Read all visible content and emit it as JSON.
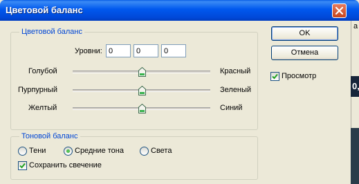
{
  "window": {
    "title": "Цветовой баланс",
    "close_icon": "close-icon"
  },
  "background": {
    "top_glyph": "а",
    "dark_text": "0,"
  },
  "color_balance": {
    "legend": "Цветовой баланс",
    "levels_label": "Уровни:",
    "levels": [
      "0",
      "0",
      "0"
    ],
    "sliders": [
      {
        "left": "Голубой",
        "right": "Красный",
        "value": 0
      },
      {
        "left": "Пурпурный",
        "right": "Зеленый",
        "value": 0
      },
      {
        "left": "Желтый",
        "right": "Синий",
        "value": 0
      }
    ],
    "slider_range": [
      -100,
      100
    ]
  },
  "tone_balance": {
    "legend": "Тоновой баланс",
    "options": [
      "Тени",
      "Средние тона",
      "Света"
    ],
    "selected": "Средние тона",
    "preserve_label": "Сохранить свечение",
    "preserve_checked": true
  },
  "buttons": {
    "ok": "OK",
    "cancel": "Отмена"
  },
  "preview": {
    "label": "Просмотр",
    "checked": true
  },
  "colors": {
    "title_bar": "#0058ee",
    "group_legend": "#0046d5",
    "close": "#c8461e",
    "check": "#21a121"
  }
}
